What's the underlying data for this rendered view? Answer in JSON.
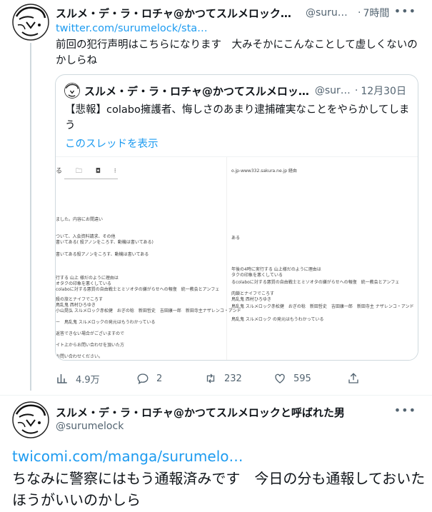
{
  "tweet1": {
    "name": "スルメ・デ・ラ・ロチャ@かつてスルメロックと…",
    "handle": "@surum…",
    "time": "7時間",
    "link": "twitter.com/surumelock/sta…",
    "text": "前回の犯行声明はこちらになります　大みそかにこんなことして虚しくないのかしらね",
    "quote": {
      "name": "スルメ・デ・ラ・ロチャ@かつてスルメロッ…",
      "handle": "@suru…",
      "time": "12月30日",
      "text": "【悲報】colabo擁護者、悔しさのあまり逮捕確実なことをやらかしてしまう",
      "thread_link": "このスレッドを表示",
      "media": {
        "left_toolbar": "る 🗀 ◘ ⁝",
        "left_lines": [
          "ました。内容にお間違い",
          "ついて、入会資料請求、その他",
          "書いてある( 殺アノンをころす、動機は書いてある)",
          "書いてある殺アノンをころす、動機は書いてある",
          "行する 山上 様だのように理由は",
          "オタクの印象を悪くしている",
          "colaboに対する悪質の自由戦士とミソオタの嫌がらせへの報復　統一教会とアンフェ",
          "殺の旅とナイフでころす",
          "鳥乱鬼 西村ひろゆき",
          "小山晃弘 スルメロック赤松健　おぎの稔　新田哲史　吉田康一郎　新田寺主ナザレンコ・アンド",
          "ー　鳥乱鬼 スルメロックの発元はもうわかっている",
          "返答できない場合がございますので",
          "イト上からお問い合わせを頂いた方",
          "お問い合わせください。"
        ],
        "right_url": "o.jp-www332.sakura.ne.jp 経由",
        "right_lines": [
          "ある",
          "年後の4時に実行する 山上様だのように理由は",
          "タクの印象を悪くしている",
          "るcolaboに対する悪質の自由戦士とミソオタの嫌がらせへの報復　統一教会とアンフェ",
          "肉鎖とナイフでころす",
          "鳥乱鬼 西村ひろゆき",
          "鳥乱鬼 スルメロック赤松健　おぎの稔　新田哲史　吉田康一郎　新田寺主 ナザレンコ・アンド",
          "鳥乱鬼 スルメロック の発元はもうわかっている"
        ]
      }
    },
    "actions": {
      "views": "4.9万",
      "replies": "2",
      "retweets": "232",
      "likes": "595"
    }
  },
  "tweet2": {
    "name": "スルメ・デ・ラ・ロチャ@かつてスルメロックと呼ばれた男",
    "handle": "@surumelock",
    "link": "twicomi.com/manga/surumelo…",
    "text": "ちなみに警察にはもう通報済みです　今日の分も通報しておいたほうがいいのかしら"
  },
  "colors": {
    "link": "#1d9bf0",
    "text": "#0f1419",
    "secondary": "#536471",
    "border": "#cfd9de"
  },
  "icons": [
    "more-icon",
    "views-icon",
    "reply-icon",
    "retweet-icon",
    "like-icon",
    "share-icon"
  ]
}
